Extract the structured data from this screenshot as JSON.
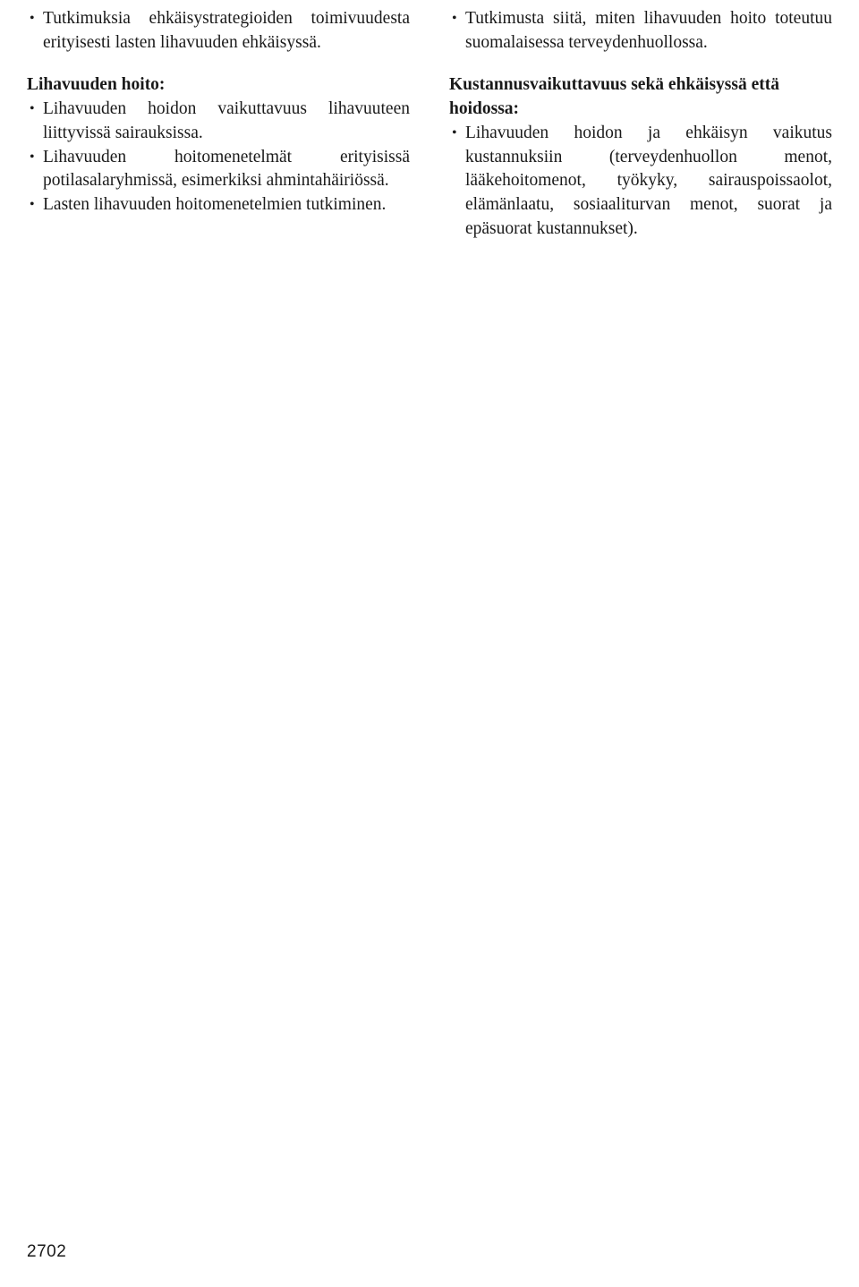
{
  "page": {
    "folio": "2702"
  },
  "left_column": {
    "top_bullets": [
      "Tutkimuksia ehkäisystrategioiden toimivuudesta erityisesti lasten lihavuuden ehkäisyssä."
    ],
    "section_heading": "Lihavuuden hoito:",
    "section_bullets": [
      "Lihavuuden hoidon vaikuttavuus lihavuuteen liittyvissä sairauksissa.",
      "Lihavuuden hoitomenetelmät erityisissä potilasalaryhmissä, esimerkiksi ahmintahäiriössä.",
      "Lasten lihavuuden hoitomenetelmien tutkiminen."
    ]
  },
  "right_column": {
    "top_bullets": [
      "Tutkimusta siitä, miten lihavuuden hoito toteutuu suomalaisessa terveydenhuollossa."
    ],
    "section_heading": "Kustannusvaikuttavuus sekä ehkäisyssä että hoidossa:",
    "section_bullets": [
      "Lihavuuden hoidon ja ehkäisyn vaikutus kustannuksiin (terveydenhuollon menot, lääkehoitomenot, työkyky, sairauspoissaolot, elämänlaatu, sosiaaliturvan menot, suorat ja epäsuorat kustannukset)."
    ]
  }
}
